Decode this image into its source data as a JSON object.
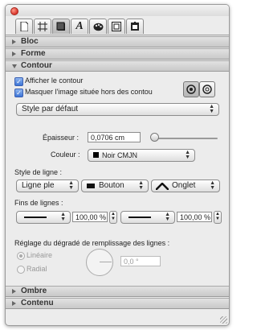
{
  "tabs": [
    {
      "name": "document-tab",
      "icon": "document-icon"
    },
    {
      "name": "layout-tab",
      "icon": "frame-icon"
    },
    {
      "name": "graphic-tab",
      "icon": "graphic-icon"
    },
    {
      "name": "text-tab",
      "icon": "text-a-icon",
      "glyph": "A"
    },
    {
      "name": "color-tab",
      "icon": "palette-icon"
    },
    {
      "name": "metrics-tab",
      "icon": "metrics-icon"
    },
    {
      "name": "info-tab",
      "icon": "info-icon"
    }
  ],
  "sections": {
    "bloc": "Bloc",
    "forme": "Forme",
    "contour": "Contour",
    "ombre": "Ombre",
    "contenu": "Contenu"
  },
  "contour": {
    "show_stroke_label": "Afficher le contour",
    "show_stroke_checked": true,
    "mask_image_label": "Masquer l'image située hors des contou",
    "mask_image_checked": true,
    "style_value": "Style par défaut",
    "epaisseur_label": "Épaisseur :",
    "epaisseur_value": "0,0706 cm",
    "couleur_label": "Couleur :",
    "couleur_value": "Noir CMJN",
    "couleur_swatch": "#000000",
    "style_ligne_label": "Style de ligne :",
    "line_style_value": "Ligne ple",
    "cap_value": "Bouton",
    "join_value": "Onglet",
    "fins_label": "Fins de lignes :",
    "start_percent": "100,00 %",
    "end_percent": "100,00 %",
    "gradient_label": "Réglage du dégradé de remplissage des lignes :",
    "lineaire_label": "Linéaire",
    "radial_label": "Radial",
    "angle_value": "0,0 °"
  },
  "colors": {
    "accent": "#3c74d6",
    "close": "#d8342a"
  }
}
